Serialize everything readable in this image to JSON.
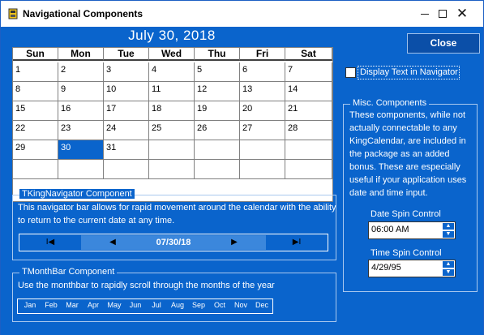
{
  "window": {
    "title": "Navigational Components",
    "controls": {
      "minimize": "—",
      "maximize": "☐",
      "close": "✕"
    }
  },
  "calendar": {
    "title": "July 30, 2018",
    "weekdays": [
      "Sun",
      "Mon",
      "Tue",
      "Wed",
      "Thu",
      "Fri",
      "Sat"
    ],
    "weeks": [
      [
        "1",
        "2",
        "3",
        "4",
        "5",
        "6",
        "7"
      ],
      [
        "8",
        "9",
        "10",
        "11",
        "12",
        "13",
        "14"
      ],
      [
        "15",
        "16",
        "17",
        "18",
        "19",
        "20",
        "21"
      ],
      [
        "22",
        "23",
        "24",
        "25",
        "26",
        "27",
        "28"
      ],
      [
        "29",
        "30",
        "31",
        "",
        "",
        "",
        ""
      ],
      [
        "",
        "",
        "",
        "",
        "",
        "",
        ""
      ]
    ],
    "selected_day": "30"
  },
  "close_button": {
    "label": "Close"
  },
  "display_text_checkbox": {
    "label": "Display Text  in Navigator",
    "checked": false
  },
  "navigator_group": {
    "label": "TKingNavigator Component",
    "description": "This navigator bar allows for rapid movement around the calendar with the ability to return to the current date at any time.",
    "date": "07/30/18",
    "buttons": {
      "first": "I◀",
      "prev": "◀",
      "next": "▶",
      "last": "▶I"
    }
  },
  "monthbar_group": {
    "label": "TMonthBar Component",
    "description": "Use the monthbar to rapidly scroll through the months of the year",
    "months": [
      "Jan",
      "Feb",
      "Mar",
      "Apr",
      "May",
      "Jun",
      "Jul",
      "Aug",
      "Sep",
      "Oct",
      "Nov",
      "Dec"
    ]
  },
  "misc_group": {
    "label": "Misc. Components",
    "description": "These components, while not actually connectable to any KingCalendar, are included in the package as an added bonus.  These are especially useful if your application uses date and time input.",
    "date_spin": {
      "label": "Date Spin Control",
      "value": "06:00 AM"
    },
    "time_spin": {
      "label": "Time Spin Control",
      "value": "4/29/95"
    }
  },
  "colors": {
    "background": "#0a64cc",
    "selected_day": "#0a64cc",
    "navigator_middle": "#3b87dc"
  }
}
